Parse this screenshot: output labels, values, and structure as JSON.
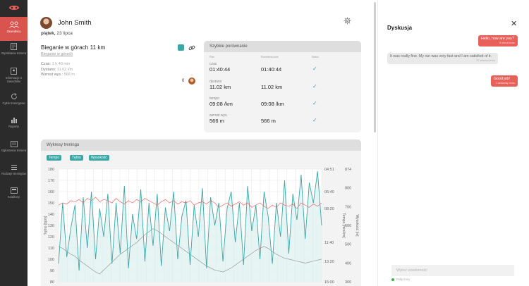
{
  "nav": {
    "items": [
      {
        "label": "Zawodnicy",
        "icon": "athletes-icon",
        "active": true
      },
      {
        "label": "Wyrabiania trenera",
        "icon": "document-icon"
      },
      {
        "label": "Informacje o zawodniku",
        "icon": "profile-icon"
      },
      {
        "label": "Cykle treningowe",
        "icon": "cycle-icon"
      },
      {
        "label": "Raporty",
        "icon": "chart-icon"
      },
      {
        "label": "Ogłoszenia trenera",
        "icon": "announcement-icon"
      },
      {
        "label": "Rodzaje treningów",
        "icon": "list-icon"
      },
      {
        "label": "Szablony",
        "icon": "template-icon"
      }
    ]
  },
  "header": {
    "user_name": "John Smith",
    "day": "piątek,",
    "date": "23 lipca"
  },
  "activity": {
    "title": "Bieganie w górach 11 km",
    "subtitle": "Bieganie w górach",
    "stats": [
      {
        "label": "Czas:",
        "value": "1 h 40 min"
      },
      {
        "label": "Dystans:",
        "value": "11.02 km"
      },
      {
        "label": "Wzrost wys.:",
        "value": "566 m"
      }
    ],
    "likes": "0"
  },
  "compare": {
    "title": "Szybkie porównanie",
    "col_plan": "Plan",
    "col_real": "Rozmieszczone",
    "col_status": "Status",
    "rows": [
      {
        "key": "czas",
        "plan": "01:40:44",
        "real": "01:40:44",
        "check": "✓"
      },
      {
        "key": "dystans",
        "plan": "11.02 km",
        "real": "11.02 km",
        "check": "✓"
      },
      {
        "key": "tempo",
        "plan": "09:08 /km",
        "real": "09:08 /km",
        "check": "✓"
      },
      {
        "key": "wzrost wys.",
        "plan": "566 m",
        "real": "566 m",
        "check": "✓"
      }
    ]
  },
  "training": {
    "title": "Wykresy treningu",
    "tabs": [
      "Tempo",
      "Tętno",
      "Wysokość"
    ]
  },
  "chart_data": {
    "type": "line",
    "title": "Wykresy treningu",
    "y_left": {
      "label": "Tętno [bpm]",
      "ticks": [
        180,
        170,
        160,
        150,
        140,
        130,
        120,
        110,
        100,
        90,
        80
      ],
      "range": [
        80,
        180
      ]
    },
    "y_right_inner": {
      "label": "Tempo [min/km]",
      "ticks": [
        "04:51",
        "06:40",
        "08:20",
        "11:40",
        "13:20",
        "15:00"
      ]
    },
    "y_right_outer": {
      "label": "Wysokość [m]",
      "ticks": [
        874,
        800,
        700,
        600,
        500,
        400,
        300
      ],
      "range": [
        300,
        874
      ]
    },
    "series": [
      {
        "key": "tempo",
        "color": "#3aa6a6",
        "values": [
          96,
          150,
          102,
          128,
          148,
          90,
          155,
          110,
          160,
          100,
          145,
          120,
          158,
          96,
          150,
          105,
          165,
          92,
          140,
          118,
          162,
          98,
          150,
          112,
          158,
          94,
          146,
          125,
          160,
          100,
          138,
          152,
          95,
          148,
          120,
          163,
          92,
          155,
          130,
          150,
          98,
          145,
          160,
          115,
          150,
          95,
          165,
          125,
          148,
          100,
          160,
          138,
          96,
          150,
          120,
          170,
          105,
          158,
          135,
          175,
          118,
          168,
          150,
          178,
          130
        ]
      },
      {
        "key": "tętno",
        "color": "#e86b6b",
        "values": [
          148,
          150,
          149,
          152,
          151,
          153,
          150,
          154,
          152,
          155,
          151,
          153,
          152,
          150,
          154,
          151,
          149,
          152,
          150,
          153,
          151,
          154,
          152,
          150,
          148,
          151,
          153,
          150,
          152,
          149,
          151,
          150,
          152,
          148,
          150,
          151,
          149,
          152,
          150,
          146,
          148,
          150,
          147,
          149,
          151,
          148,
          150,
          146,
          148,
          150,
          147,
          145,
          148,
          146,
          150,
          148,
          147,
          149,
          145,
          150,
          148,
          146,
          149,
          147,
          150
        ]
      },
      {
        "key": "wysokość",
        "color": "#9a9a9a",
        "values": [
          480,
          470,
          455,
          440,
          430,
          410,
          395,
          380,
          365,
          350,
          340,
          360,
          380,
          400,
          420,
          440,
          455,
          470,
          485,
          500,
          520,
          540,
          555,
          570,
          560,
          545,
          530,
          515,
          500,
          485,
          470,
          455,
          440,
          425,
          410,
          395,
          380,
          370,
          360,
          355,
          350,
          360,
          370,
          385,
          400,
          415,
          430,
          445,
          460,
          470,
          480,
          470,
          455,
          440,
          430,
          420,
          415,
          410,
          405,
          400,
          395,
          400,
          405,
          410,
          415
        ]
      }
    ],
    "grid": true
  },
  "chat": {
    "title": "Dyskusja",
    "messages": [
      {
        "from": "me",
        "text": "Hello, how are you?",
        "time": "5 minut temu"
      },
      {
        "from": "them",
        "text": "It was really fine. My run was very fast and I am satisfied of it.",
        "time": "37 sekund temu"
      },
      {
        "from": "me",
        "text": "Good job!",
        "time": "1 sekundę temu"
      }
    ],
    "placeholder": "Wpisz wiadomość",
    "status": "Połączony"
  }
}
